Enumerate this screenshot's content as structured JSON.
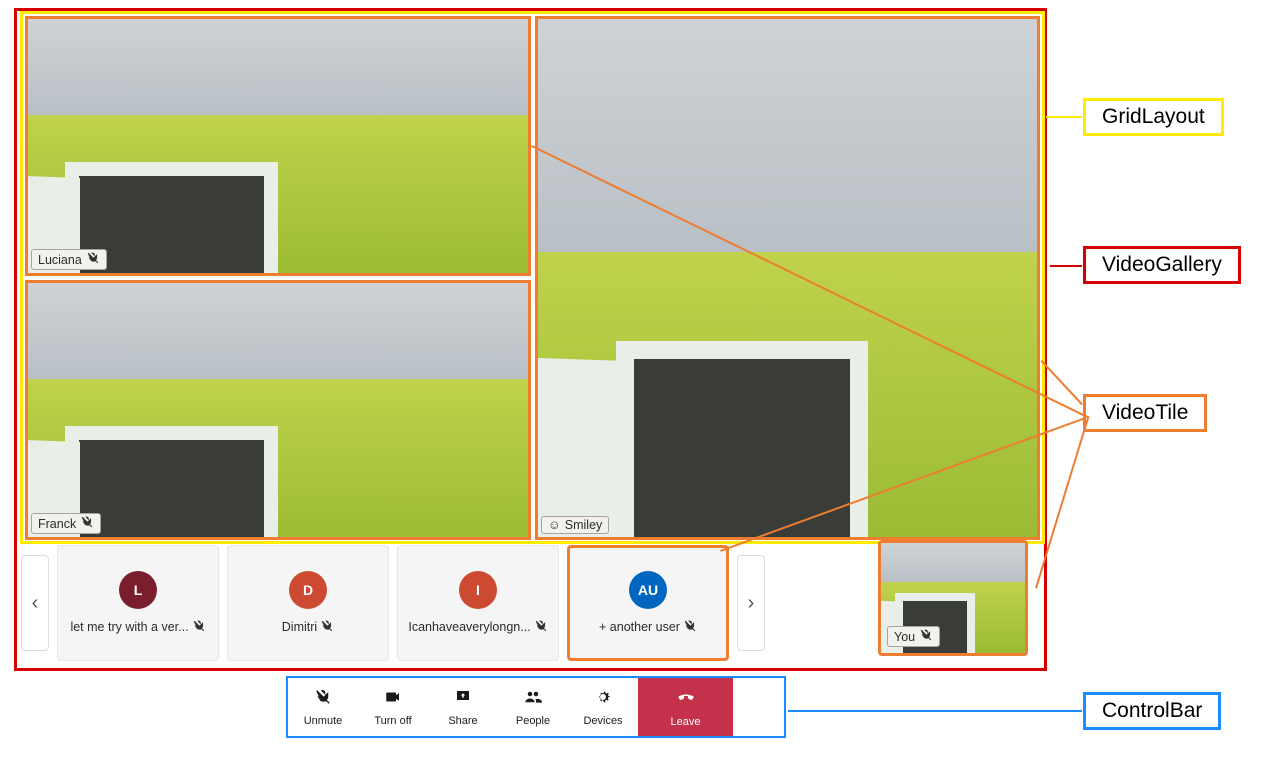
{
  "annotations": {
    "grid_layout": "GridLayout",
    "video_gallery": "VideoGallery",
    "video_tile": "VideoTile",
    "control_bar": "ControlBar"
  },
  "grid_tiles": [
    {
      "name": "Luciana",
      "muted": true,
      "has_smile": false
    },
    {
      "name": "Franck",
      "muted": true,
      "has_smile": false
    },
    {
      "name": "Smiley",
      "muted": false,
      "has_smile": true
    }
  ],
  "strip": {
    "tiles": [
      {
        "initials": "L",
        "color": "#7a1e2e",
        "label": "let me try with a ver...",
        "muted": true
      },
      {
        "initials": "D",
        "color": "#cc4a31",
        "label": "Dimitri",
        "muted": true
      },
      {
        "initials": "I",
        "color": "#cc4a31",
        "label": "Icanhaveaverylongn...",
        "muted": true
      },
      {
        "initials": "AU",
        "color": "#0067c0",
        "label": "+ another user",
        "muted": true
      }
    ]
  },
  "pip": {
    "label": "You",
    "muted": true
  },
  "control_bar": {
    "unmute": "Unmute",
    "turnoff": "Turn off",
    "share": "Share",
    "people": "People",
    "devices": "Devices",
    "leave": "Leave"
  },
  "colors": {
    "annotation_orange": "#ed7d31",
    "annotation_yellow": "#ffea00",
    "annotation_red": "#d60000",
    "annotation_blue": "#1a8cff",
    "leave_bg": "#c4314b"
  }
}
